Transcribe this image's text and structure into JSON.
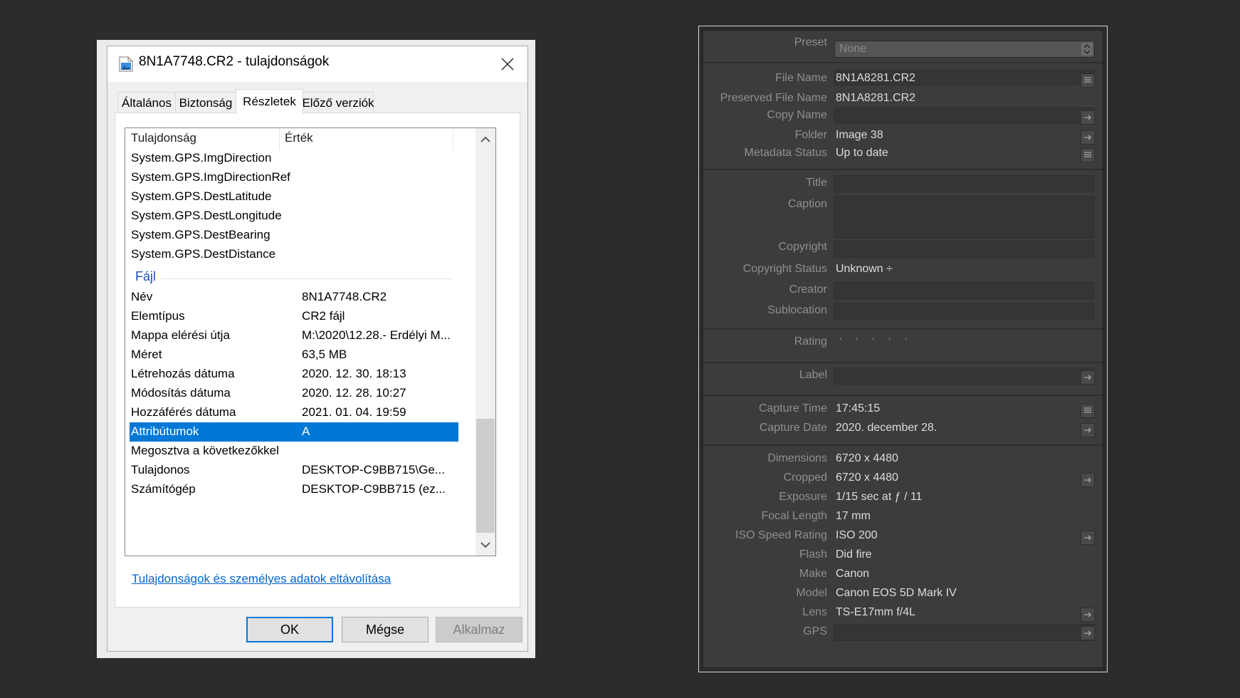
{
  "dialog": {
    "title": "8N1A7748.CR2 - tulajdonságok",
    "tabs": [
      "Általános",
      "Biztonság",
      "Részletek",
      "Előző verziók"
    ],
    "active_tab": "Részletek",
    "columns": [
      "Tulajdonság",
      "Érték"
    ],
    "gps_rows": [
      "System.GPS.ImgDirection",
      "System.GPS.ImgDirectionRef",
      "System.GPS.DestLatitude",
      "System.GPS.DestLongitude",
      "System.GPS.DestBearing",
      "System.GPS.DestDistance"
    ],
    "group_file": "Fájl",
    "file_rows": [
      {
        "property": "Név",
        "value": "8N1A7748.CR2"
      },
      {
        "property": "Elemtípus",
        "value": "CR2 fájl"
      },
      {
        "property": "Mappa elérési útja",
        "value": "M:\\2020\\12.28.- Erdélyi M..."
      },
      {
        "property": "Méret",
        "value": "63,5 MB"
      },
      {
        "property": "Létrehozás dátuma",
        "value": "2020. 12. 30. 18:13"
      },
      {
        "property": "Módosítás dátuma",
        "value": "2020. 12. 28. 10:27"
      },
      {
        "property": "Hozzáférés dátuma",
        "value": "2021. 01. 04. 19:59"
      },
      {
        "property": "Attribútumok",
        "value": "A"
      },
      {
        "property": "Megosztva a következőkkel",
        "value": ""
      },
      {
        "property": "Tulajdonos",
        "value": "DESKTOP-C9BB715\\Ge..."
      },
      {
        "property": "Számítógép",
        "value": "DESKTOP-C9BB715 (ez..."
      }
    ],
    "selected_row": "Attribútumok",
    "remove_link": "Tulajdonságok és személyes adatok eltávolítása",
    "buttons": {
      "ok": "OK",
      "cancel": "Mégse",
      "apply": "Alkalmaz"
    }
  },
  "lightroom": {
    "preset": {
      "label": "Preset",
      "value": "None"
    },
    "file_name": {
      "label": "File Name",
      "value": "8N1A8281.CR2"
    },
    "preserved_file_name": {
      "label": "Preserved File Name",
      "value": "8N1A8281.CR2"
    },
    "copy_name": {
      "label": "Copy Name",
      "value": ""
    },
    "folder": {
      "label": "Folder",
      "value": "Image 38"
    },
    "metadata_status": {
      "label": "Metadata Status",
      "value": "Up to date"
    },
    "title": {
      "label": "Title",
      "value": ""
    },
    "caption": {
      "label": "Caption",
      "value": ""
    },
    "copyright": {
      "label": "Copyright",
      "value": ""
    },
    "copyright_status": {
      "label": "Copyright Status",
      "value": "Unknown ÷"
    },
    "creator": {
      "label": "Creator",
      "value": ""
    },
    "sublocation": {
      "label": "Sublocation",
      "value": ""
    },
    "rating": {
      "label": "Rating",
      "value": 0,
      "max": 5
    },
    "label": {
      "label": "Label",
      "value": ""
    },
    "capture_time": {
      "label": "Capture Time",
      "value": "17:45:15"
    },
    "capture_date": {
      "label": "Capture Date",
      "value": "2020. december 28."
    },
    "dimensions": {
      "label": "Dimensions",
      "value": "6720 x 4480"
    },
    "cropped": {
      "label": "Cropped",
      "value": "6720 x 4480"
    },
    "exposure": {
      "label": "Exposure",
      "value": "1/15 sec at ƒ / 11"
    },
    "focal_length": {
      "label": "Focal Length",
      "value": "17 mm"
    },
    "iso": {
      "label": "ISO Speed Rating",
      "value": "ISO 200"
    },
    "flash": {
      "label": "Flash",
      "value": "Did fire"
    },
    "make": {
      "label": "Make",
      "value": "Canon"
    },
    "model": {
      "label": "Model",
      "value": "Canon EOS 5D Mark IV"
    },
    "lens": {
      "label": "Lens",
      "value": "TS-E17mm f/4L"
    },
    "gps": {
      "label": "GPS",
      "value": ""
    }
  }
}
